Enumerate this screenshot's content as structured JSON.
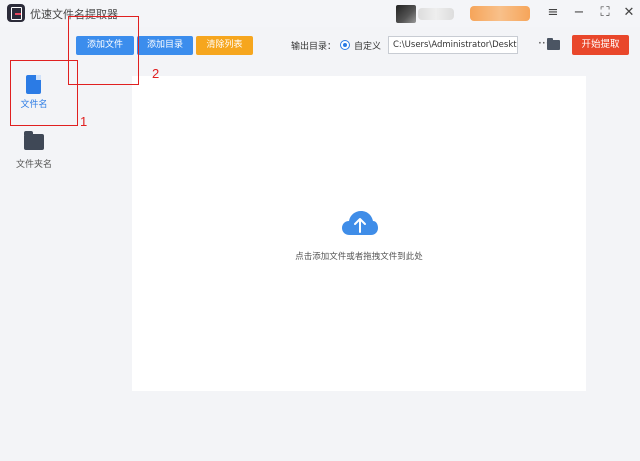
{
  "window": {
    "title": "优速文件名提取器",
    "menu_icon": "≡",
    "minimize_icon": "−",
    "maximize_icon": "⛶",
    "close_icon": "✕"
  },
  "sidebar": {
    "items": [
      {
        "label": "文件名",
        "icon": "file-icon",
        "active": true
      },
      {
        "label": "文件夹名",
        "icon": "folder-icon",
        "active": false
      }
    ]
  },
  "toolbar": {
    "add_file_label": "添加文件",
    "add_dir_label": "添加目录",
    "clear_label": "清除列表",
    "output_label": "输出目录：",
    "custom_label": "自定义",
    "output_path": "C:\\Users\\Administrator\\Deskto",
    "more_icon": "···",
    "start_label": "开始提取"
  },
  "main": {
    "hint": "点击添加文件或者拖拽文件到此处"
  },
  "annotations": {
    "num1": "1",
    "num2": "2"
  },
  "colors": {
    "primary": "#3b8ded",
    "warning": "#f6a61e",
    "danger": "#e9472b",
    "annotation": "#e02020"
  }
}
